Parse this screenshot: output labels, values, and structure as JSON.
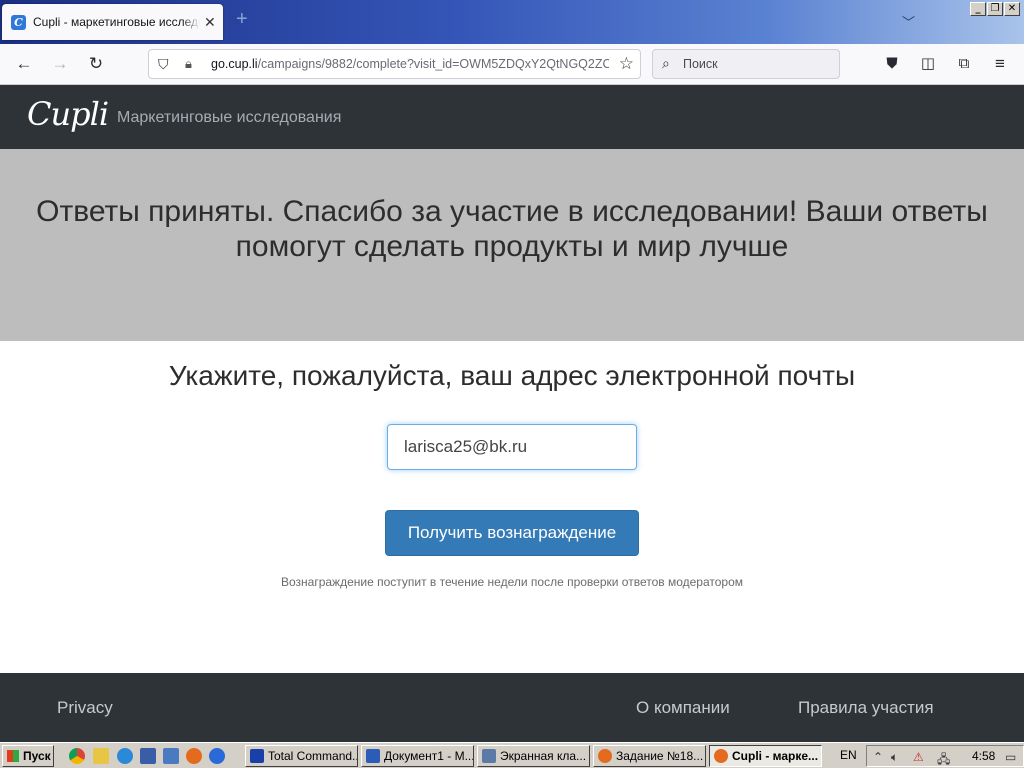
{
  "browser": {
    "tab_title": "Cupli - маркетинговые исследования",
    "tab_close": "✕",
    "new_tab": "+",
    "url_host": "go.cup.li",
    "url_path": "/campaigns/9882/complete?visit_id=OWM5ZDQxY2QtNGQ2ZC",
    "search_placeholder": "Поиск",
    "icons": [
      "back-icon",
      "forward-icon",
      "reload-icon",
      "shield-icon",
      "permissions-icon",
      "bookmark-star-icon",
      "search-icon",
      "pocket-icon",
      "sidebar-icon",
      "extensions-icon",
      "menu-icon"
    ]
  },
  "site": {
    "logo": "Cupli",
    "nav_title": "Маркетинговые исследования",
    "hero_text": "Ответы приняты. Спасибо за участие в исследовании! Ваши ответы помогут сделать продукты и мир лучше",
    "email_prompt": "Укажите, пожалуйста, ваш адрес электронной почты",
    "email_value": "larisca25@bk.ru",
    "reward_button": "Получить вознаграждение",
    "reward_note": "Вознаграждение поступит в течение недели после проверки ответов модератором",
    "footer": {
      "privacy": "Privacy",
      "about": "О компании",
      "rules": "Правила участия"
    }
  },
  "taskbar": {
    "start": "Пуск",
    "tasks": [
      {
        "label": "Total Command...",
        "icon_color": "#1a3fa8"
      },
      {
        "label": "Документ1 - M...",
        "icon_color": "#2a5cb8"
      },
      {
        "label": "Экранная кла...",
        "icon_color": "#5c7aa8"
      },
      {
        "label": "Задание №18...",
        "icon_color": "#e46a1e"
      },
      {
        "label": "Cupli - марке...",
        "icon_color": "#e46a1e"
      }
    ],
    "language": "EN",
    "time": "4:58"
  },
  "colors": {
    "header_bg": "#2e3338",
    "hero_bg": "#bdbdbd",
    "button_primary": "#337ab7"
  }
}
